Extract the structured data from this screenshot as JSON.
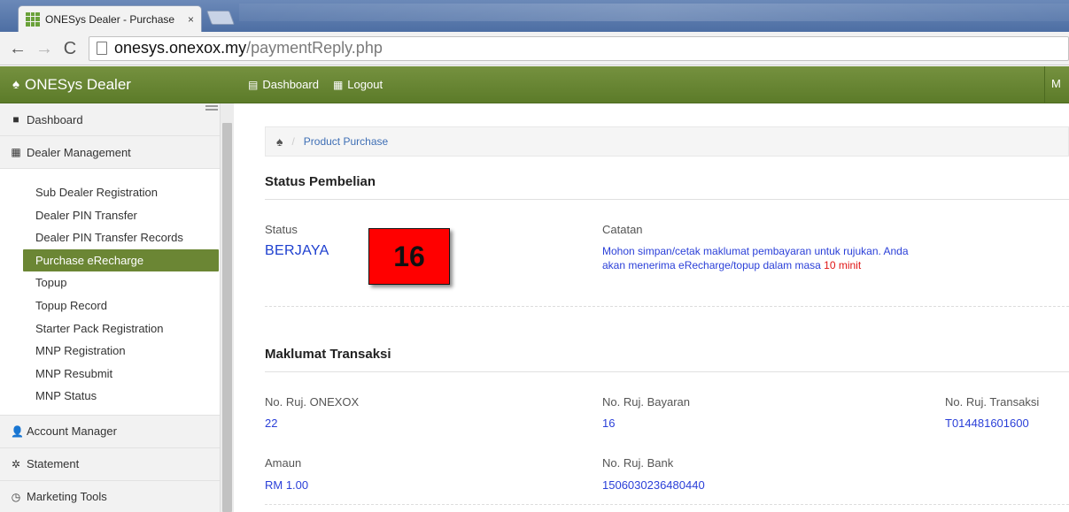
{
  "browser": {
    "tab_title": "ONESys Dealer - Purchase",
    "tab_close": "×",
    "url_host": "onesys.onexox.my",
    "url_path": "/paymentReply.php"
  },
  "navbar": {
    "brand": "ONESys Dealer",
    "dashboard": "Dashboard",
    "logout": "Logout",
    "right_text": "M"
  },
  "sidebar": {
    "items_top": [
      {
        "label": "Dashboard",
        "icon": "folder-icon"
      },
      {
        "label": "Dealer Management",
        "icon": "grid-icon"
      }
    ],
    "sub_items": [
      {
        "label": "Sub Dealer Registration",
        "active": false
      },
      {
        "label": "Dealer PIN Transfer",
        "active": false
      },
      {
        "label": "Dealer PIN Transfer Records",
        "active": false
      },
      {
        "label": "Purchase eRecharge",
        "active": true
      },
      {
        "label": "Topup",
        "active": false
      },
      {
        "label": "Topup Record",
        "active": false
      },
      {
        "label": "Starter Pack Registration",
        "active": false
      },
      {
        "label": "MNP Registration",
        "active": false
      },
      {
        "label": "MNP Resubmit",
        "active": false
      },
      {
        "label": "MNP Status",
        "active": false
      }
    ],
    "items_bottom": [
      {
        "label": "Account Manager",
        "icon": "user-icon"
      },
      {
        "label": "Statement",
        "icon": "gear-icon"
      },
      {
        "label": "Marketing Tools",
        "icon": "clock-icon"
      }
    ]
  },
  "breadcrumb": {
    "current": "Product Purchase"
  },
  "status_section": {
    "title": "Status Pembelian",
    "status_label": "Status",
    "status_value": "BERJAYA",
    "note_label": "Catatan",
    "note_text": "Mohon simpan/cetak maklumat pembayaran untuk rujukan. Anda akan menerima eRecharge/topup dalam masa ",
    "note_highlight": "10 minit"
  },
  "annotation_badge": "16",
  "transaction_section": {
    "title": "Maklumat Transaksi",
    "fields": {
      "onexox_ref_label": "No. Ruj. ONEXOX",
      "onexox_ref_value": "22",
      "payment_ref_label": "No. Ruj. Bayaran",
      "payment_ref_value": "16",
      "transaction_ref_label": "No. Ruj. Transaksi",
      "transaction_ref_value": "T014481601600",
      "amount_label": "Amaun",
      "amount_value": "RM 1.00",
      "bank_ref_label": "No. Ruj. Bank",
      "bank_ref_value": "1506030236480440"
    }
  },
  "colors": {
    "navbar_green": "#5f7e2c",
    "active_item": "#6b8634",
    "value_blue": "#2a3fd8",
    "badge_red": "#ff0000"
  }
}
